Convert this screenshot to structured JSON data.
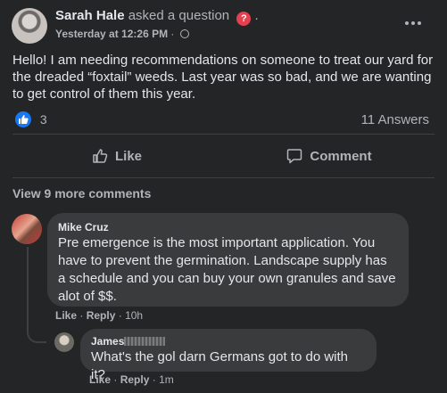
{
  "post": {
    "author": "Sarah Hale",
    "action": "asked a question",
    "badge": "?",
    "punct": ".",
    "time": "Yesterday at 12:26 PM",
    "separator": "·",
    "more_icon": "more-horizontal-icon",
    "text": "Hello! I am needing recommendations on someone to treat our yard for the dreaded “foxtail” weeds. Last year was so bad, and we are wanting to get control of them this year.",
    "reactions_count": "3",
    "answers": "11 Answers"
  },
  "actions": {
    "like": "Like",
    "comment": "Comment"
  },
  "view_more": "View 9 more comments",
  "comments": [
    {
      "author": "Mike Cruz",
      "text": "Pre emergence is the most important application. You have to prevent the germination. Landscape supply has a schedule and you can buy your own granules and save alot of $$.",
      "like": "Like",
      "reply": "Reply",
      "time": "10h",
      "sep": "·"
    },
    {
      "author": "James",
      "text": "What's the gol darn Germans got to do with it?",
      "like": "Like",
      "reply": "Reply",
      "time": "1m",
      "sep": "·"
    }
  ],
  "colors": {
    "background": "#242526",
    "bubble": "#3a3b3c",
    "accent": "#1877f2",
    "badge": "#e4404f",
    "secondary_text": "#b0b3b8"
  }
}
